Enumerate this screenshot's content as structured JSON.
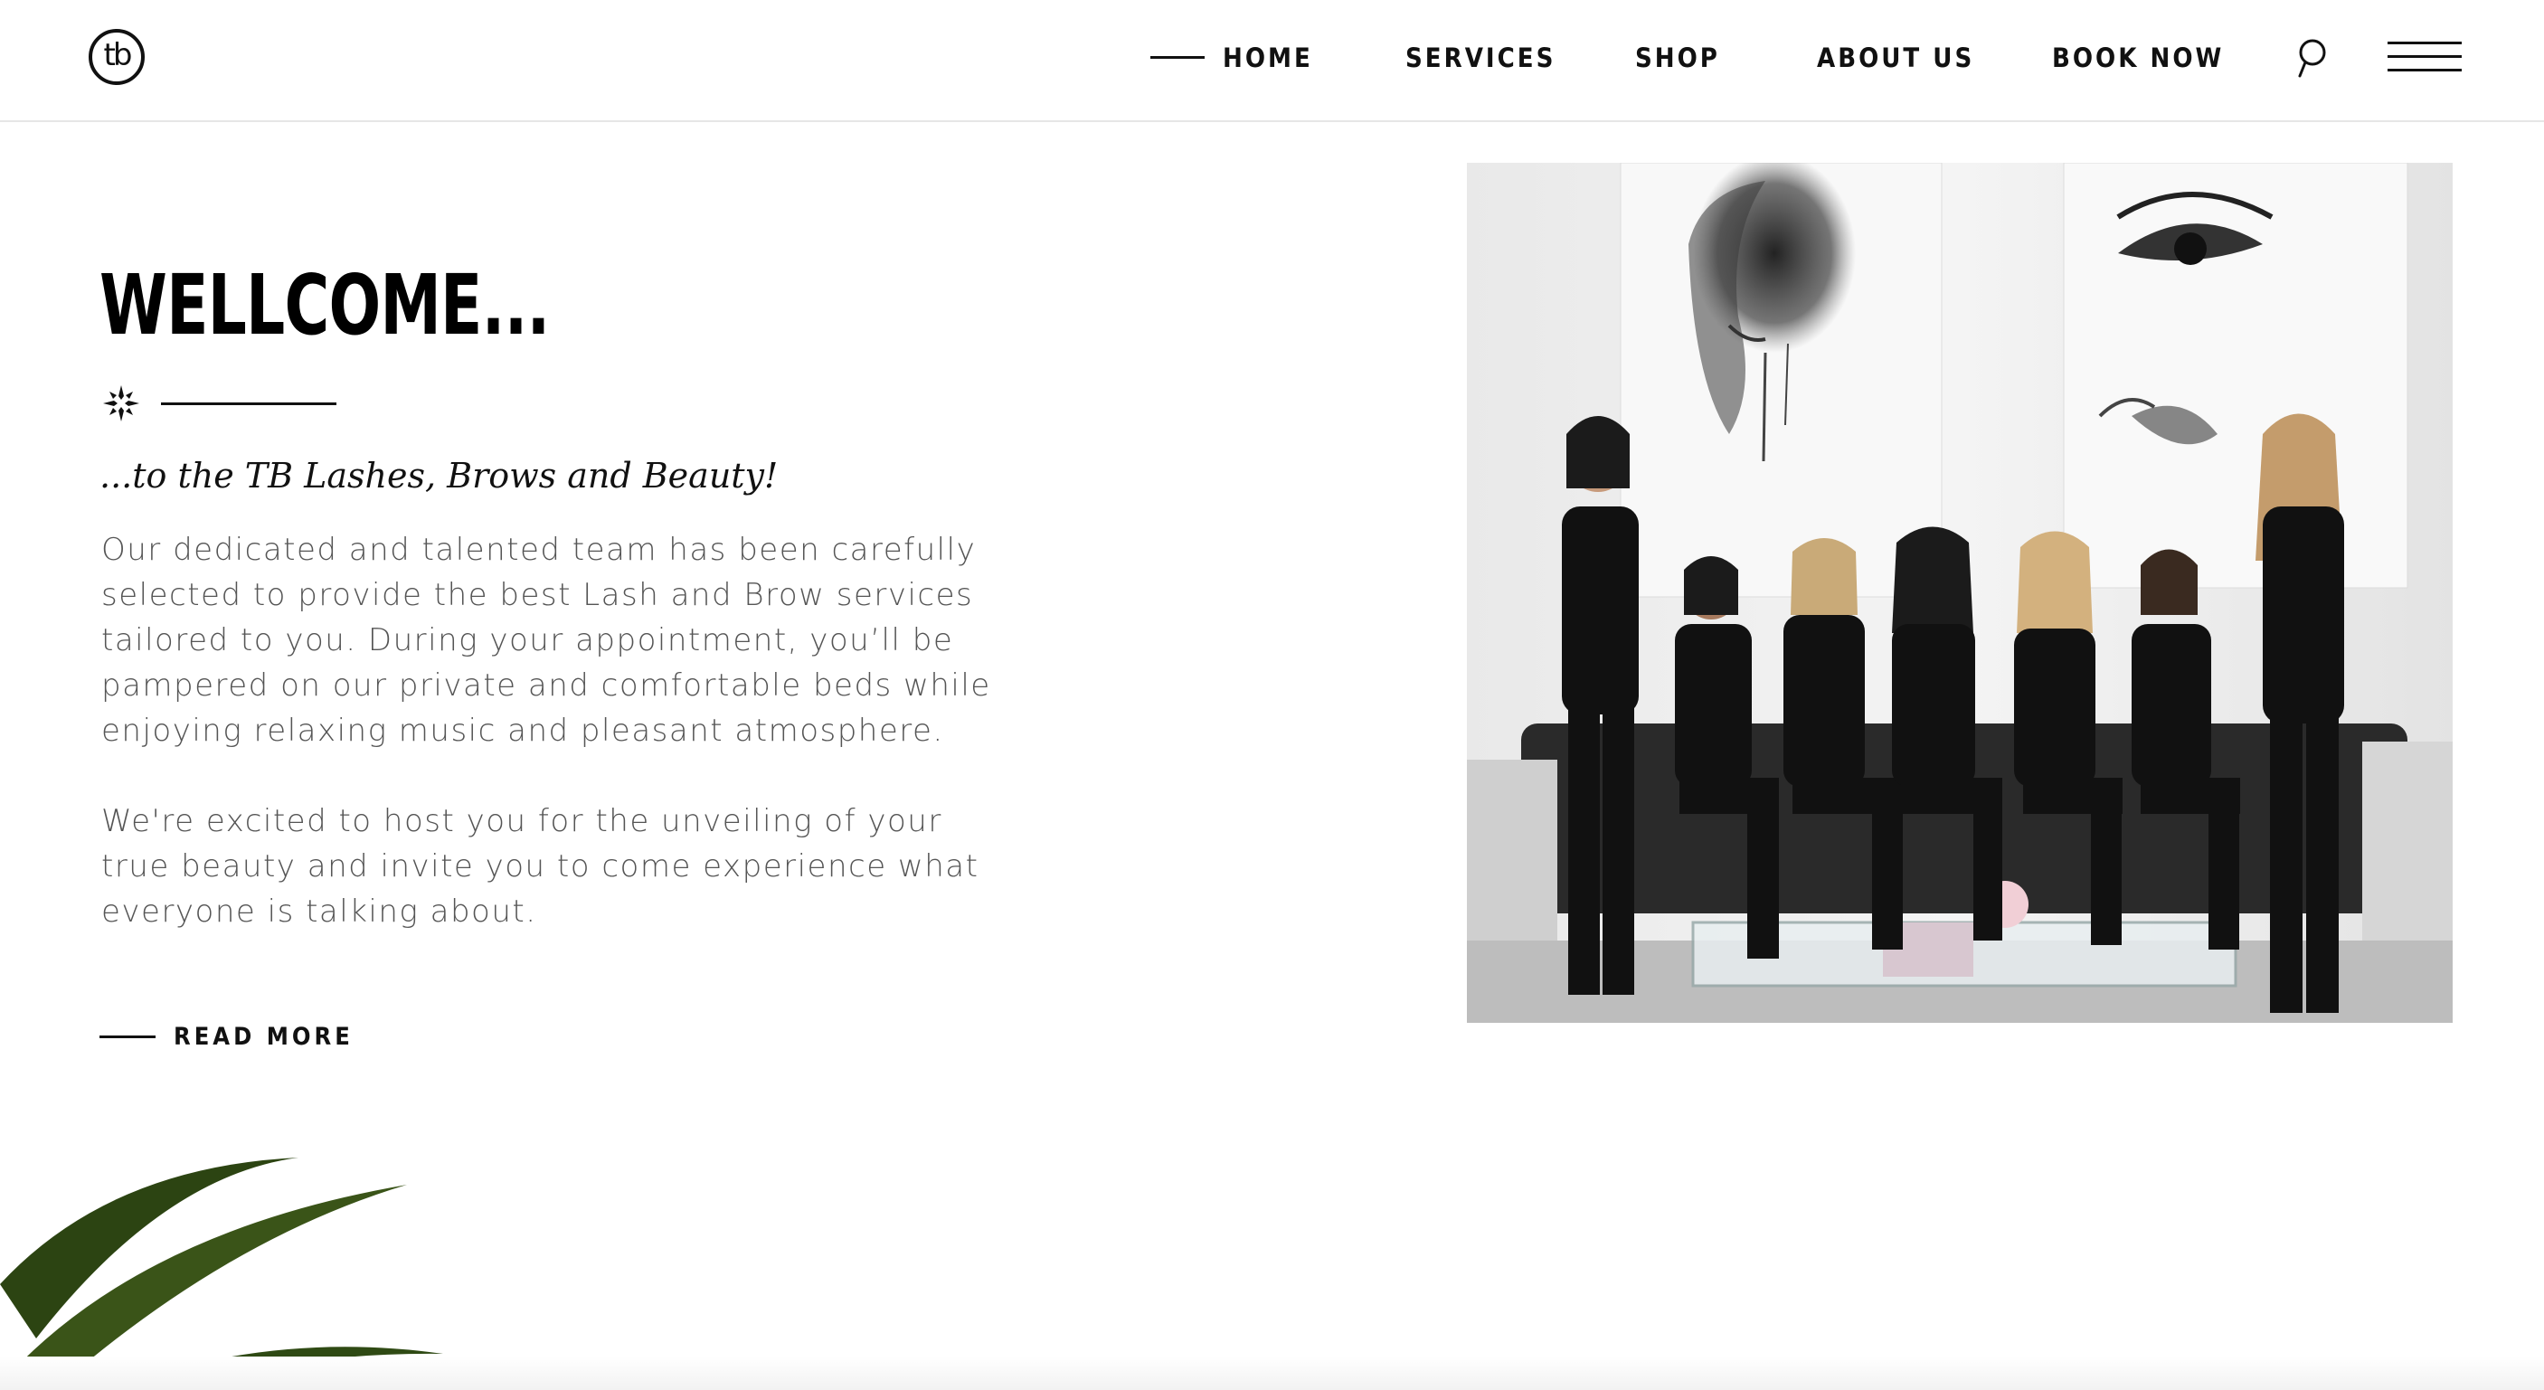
{
  "header": {
    "logo_text": "tb",
    "nav": [
      {
        "label": "HOME",
        "active": true
      },
      {
        "label": "SERVICES",
        "active": false
      },
      {
        "label": "SHOP",
        "active": false
      },
      {
        "label": "ABOUT US",
        "active": false
      },
      {
        "label": "BOOK NOW",
        "active": false
      }
    ],
    "icons": [
      "search-icon",
      "menu-icon"
    ]
  },
  "welcome": {
    "title": "WELLCOME...",
    "subtitle": "...to the TB Lashes, Brows and Beauty!",
    "paragraphs": [
      "Our dedicated and talented team has been carefully selected to provide the best Lash and Brow services tailored to you. During your appointment, you’ll be pampered on our private and comfortable beds while enjoying relaxing music and pleasant atmosphere.",
      "We're excited to host you for the unveiling of your true beauty and invite you to come experience what everyone is talking about."
    ],
    "read_more_label": "READ MORE",
    "divider_icon": "sparkle-icon"
  },
  "photo": {
    "subject": "team-photo",
    "people_count": 7
  },
  "colors": {
    "text": "#111111",
    "body_text": "#555555",
    "border": "#e6e6e6",
    "leaf": "#2c4412"
  }
}
